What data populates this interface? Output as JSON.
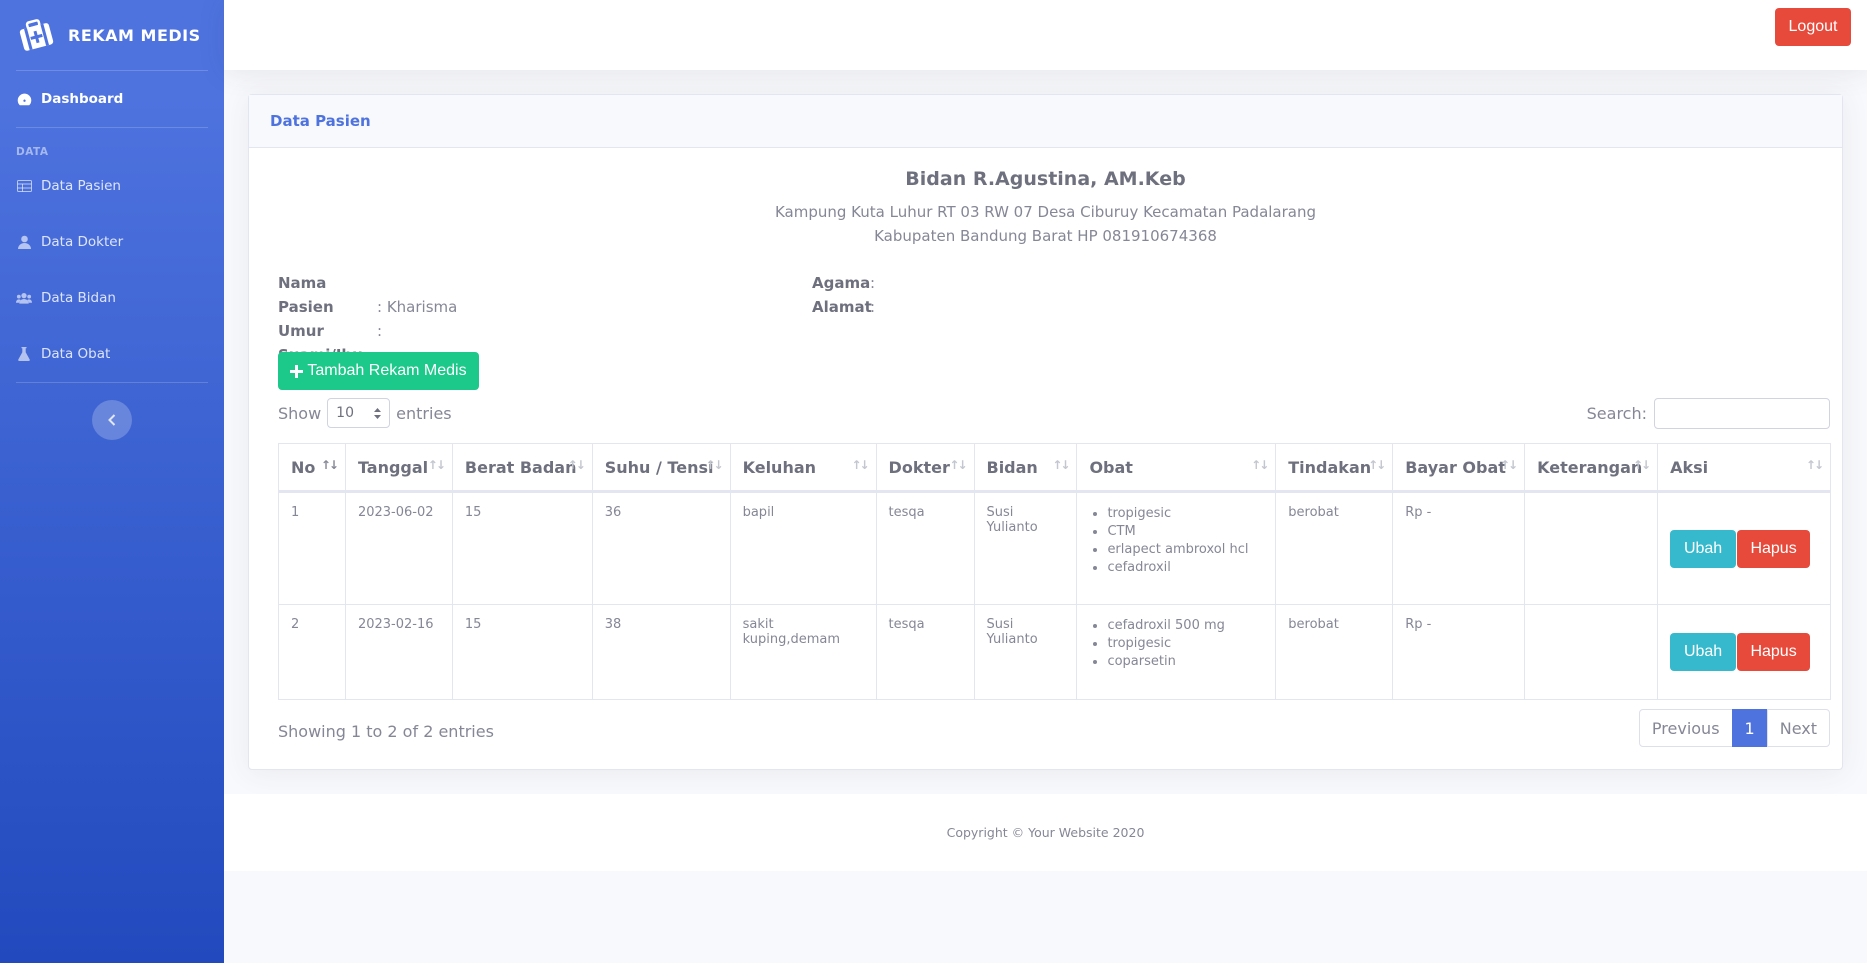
{
  "brand": {
    "title": "REKAM MEDIS"
  },
  "sidebar": {
    "dashboard": "Dashboard",
    "section_heading": "DATA",
    "items": [
      {
        "label": "Data Pasien",
        "icon": "table-icon"
      },
      {
        "label": "Data Dokter",
        "icon": "user-icon"
      },
      {
        "label": "Data Bidan",
        "icon": "users-icon"
      },
      {
        "label": "Data Obat",
        "icon": "flask-icon"
      }
    ]
  },
  "topbar": {
    "logout_label": "Logout"
  },
  "card": {
    "title": "Data Pasien"
  },
  "clinic": {
    "name": "Bidan R.Agustina, AM.Keb",
    "address_line1": "Kampung Kuta Luhur RT 03 RW 07 Desa Ciburuy Kecamatan Padalarang",
    "address_line2": "Kabupaten Bandung Barat HP 081910674368"
  },
  "patient": {
    "nama_label": "Nama Pasien",
    "nama_value": "Kharisma",
    "umur_label": "Umur",
    "umur_value": "",
    "suami_label": "Suami/Ibu",
    "suami_value": "",
    "agama_label": "Agama",
    "agama_value": "",
    "alamat_label": "Alamat",
    "alamat_value": "",
    "separator": ":"
  },
  "actions": {
    "add_label": "Tambah Rekam Medis"
  },
  "table_controls": {
    "show_label": "Show",
    "entries_label": "entries",
    "page_size": "10",
    "search_label": "Search:",
    "search_value": ""
  },
  "table": {
    "columns": [
      "No",
      "Tanggal",
      "Berat Badan",
      "Suhu / Tensi",
      "Keluhan",
      "Dokter",
      "Bidan",
      "Obat",
      "Tindakan",
      "Bayar Obat",
      "Keterangan",
      "Aksi"
    ],
    "rows": [
      {
        "no": "1",
        "tanggal": "2023-06-02",
        "berat": "15",
        "suhu": "36",
        "keluhan": "bapil",
        "dokter": "tesqa",
        "bidan": "Susi Yulianto",
        "obat": [
          "tropigesic",
          "CTM",
          "erlapect ambroxol hcl",
          "cefadroxil"
        ],
        "tindakan": "berobat",
        "bayar": "Rp -",
        "keterangan": ""
      },
      {
        "no": "2",
        "tanggal": "2023-02-16",
        "berat": "15",
        "suhu": "38",
        "keluhan": "sakit kuping,demam",
        "dokter": "tesqa",
        "bidan": "Susi Yulianto",
        "obat": [
          "cefadroxil 500 mg",
          "tropigesic",
          "coparsetin"
        ],
        "tindakan": "berobat",
        "bayar": "Rp -",
        "keterangan": ""
      }
    ],
    "ubah_label": "Ubah",
    "hapus_label": "Hapus"
  },
  "pagination": {
    "info": "Showing 1 to 2 of 2 entries",
    "previous": "Previous",
    "current": "1",
    "next": "Next"
  },
  "footer": {
    "copyright": "Copyright © Your Website 2020"
  },
  "colors": {
    "primary": "#4e73df",
    "success": "#1cc88a",
    "info": "#36b9cc",
    "danger": "#e74a3b"
  }
}
